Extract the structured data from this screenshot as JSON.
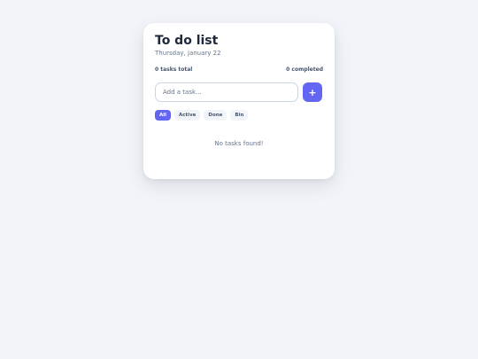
{
  "card": {
    "title": "To do list",
    "date": "Thursday, january 22"
  },
  "stats": {
    "total": "0 tasks total",
    "completed": "0 completed"
  },
  "input": {
    "placeholder": "Add a task...",
    "value": ""
  },
  "add_button": {
    "label": "+"
  },
  "filters": [
    {
      "label": "All"
    },
    {
      "label": "Active"
    },
    {
      "label": "Done"
    },
    {
      "label": "Bin"
    }
  ],
  "empty_state": {
    "text": "No tasks found!"
  },
  "colors": {
    "accent": "#6366f1",
    "background": "#f1f5f9",
    "card": "#ffffff",
    "title": "#1e293b",
    "muted": "#64748b"
  }
}
